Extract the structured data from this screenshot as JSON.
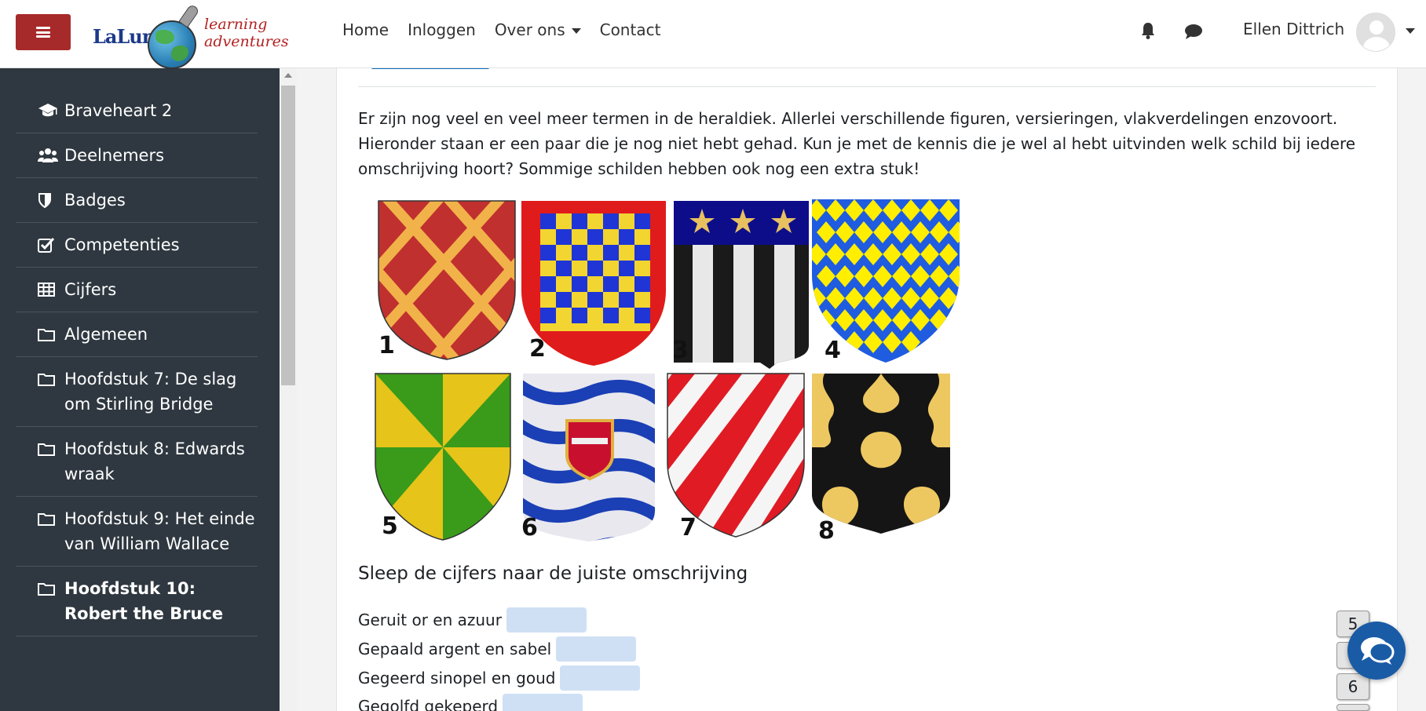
{
  "header": {
    "menu_toggle_icon": "hamburger-icon",
    "logo": {
      "brand": "LaLuna",
      "tagline_1": "learning",
      "tagline_2": "adventures"
    },
    "nav": [
      {
        "label": "Home"
      },
      {
        "label": "Inloggen"
      },
      {
        "label": "Over ons",
        "has_dropdown": true
      },
      {
        "label": "Contact"
      }
    ],
    "notifications_icon": "bell-icon",
    "messages_icon": "chat-bubble-icon",
    "user_name": "Ellen Dittrich",
    "accent_color": "#a72a2a"
  },
  "sidebar": {
    "background": "#2f3840",
    "items": [
      {
        "icon": "graduation-cap-icon",
        "label": "Braveheart 2"
      },
      {
        "icon": "users-icon",
        "label": "Deelnemers"
      },
      {
        "icon": "shield-icon",
        "label": "Badges"
      },
      {
        "icon": "checkbox-icon",
        "label": "Competenties"
      },
      {
        "icon": "table-icon",
        "label": "Cijfers"
      },
      {
        "icon": "folder-icon",
        "label": "Algemeen"
      },
      {
        "icon": "folder-icon",
        "label": "Hoofdstuk 7: De slag om Stirling Bridge"
      },
      {
        "icon": "folder-icon",
        "label": "Hoofdstuk 8: Edwards wraak"
      },
      {
        "icon": "folder-icon",
        "label": "Hoofdstuk 9: Het einde van William Wallace"
      },
      {
        "icon": "folder-icon",
        "label": "Hoofdstuk 10: Robert the Bruce",
        "bold": true
      }
    ]
  },
  "content": {
    "intro": "Er zijn nog veel en veel meer termen in de heraldiek. Allerlei verschillende figuren, versieringen, vlakverdelingen enzovoort. Hieronder staan er een paar die je nog niet hebt gehad. Kun je met de kennis die je wel al hebt uitvinden welk schild bij iedere omschrijving hoort? Sommige schilden hebben ook nog een extra stuk!",
    "shields": [
      {
        "number": "1"
      },
      {
        "number": "2"
      },
      {
        "number": "3"
      },
      {
        "number": "4"
      },
      {
        "number": "5"
      },
      {
        "number": "6"
      },
      {
        "number": "7"
      },
      {
        "number": "8"
      }
    ],
    "instruction": "Sleep de cijfers naar de juiste omschrijving",
    "descriptions": [
      {
        "label": "Geruit or en azuur"
      },
      {
        "label": "Gepaald argent en sabel"
      },
      {
        "label": "Gegeerd sinopel en goud"
      },
      {
        "label": "Gegolfd gekeperd"
      }
    ],
    "drag_chips": [
      "5",
      "",
      "6",
      ""
    ],
    "help_chat_icon": "chat-bubbles-icon"
  }
}
